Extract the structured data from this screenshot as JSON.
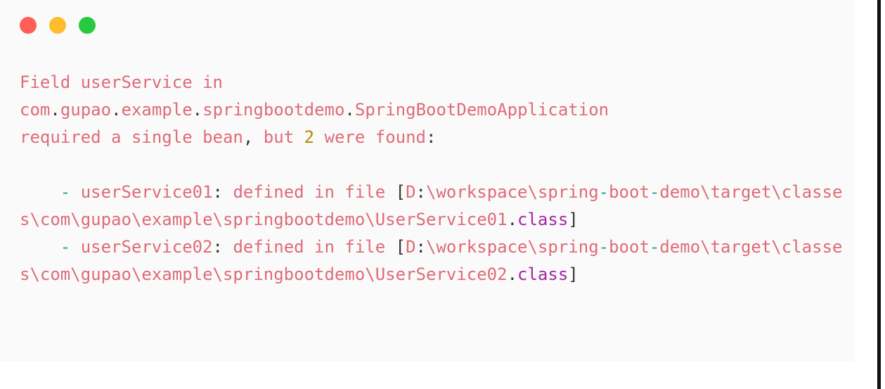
{
  "window": {
    "controls": [
      {
        "name": "close",
        "color": "#ff5f56"
      },
      {
        "name": "minimize",
        "color": "#ffbd2e"
      },
      {
        "name": "maximize",
        "color": "#27c93f"
      }
    ],
    "background": "#fafafa",
    "page_background": "#ffffff",
    "edge_stripe_color": "#111111"
  },
  "colors": {
    "text": "#df6b77",
    "number": "#b58900",
    "punctuation": "#333333",
    "dash": "#2aa198",
    "keyword": "#a626a4",
    "bracket": "#333333"
  },
  "console": {
    "lines": [
      {
        "id": "line-1",
        "tokens": [
          {
            "text": "Field userService in",
            "type": "txt"
          }
        ]
      },
      {
        "id": "line-2",
        "tokens": [
          {
            "text": "com",
            "type": "txt"
          },
          {
            "text": ".",
            "type": "punct"
          },
          {
            "text": "gupao",
            "type": "txt"
          },
          {
            "text": ".",
            "type": "punct"
          },
          {
            "text": "example",
            "type": "txt"
          },
          {
            "text": ".",
            "type": "punct"
          },
          {
            "text": "springbootdemo",
            "type": "txt"
          },
          {
            "text": ".",
            "type": "punct"
          },
          {
            "text": "SpringBootDemoApplication",
            "type": "txt"
          }
        ]
      },
      {
        "id": "line-3",
        "tokens": [
          {
            "text": "required a single bean",
            "type": "txt"
          },
          {
            "text": ",",
            "type": "punct"
          },
          {
            "text": " but ",
            "type": "txt"
          },
          {
            "text": "2",
            "type": "num"
          },
          {
            "text": " were found",
            "type": "txt"
          },
          {
            "text": ":",
            "type": "punct"
          }
        ]
      },
      {
        "id": "line-4",
        "blank": true,
        "tokens": []
      },
      {
        "id": "line-5",
        "tokens": [
          {
            "text": "    ",
            "type": "txt"
          },
          {
            "text": "-",
            "type": "dash"
          },
          {
            "text": " userService01",
            "type": "txt"
          },
          {
            "text": ":",
            "type": "punct"
          },
          {
            "text": " defined in file ",
            "type": "txt"
          },
          {
            "text": "[",
            "type": "bracket"
          },
          {
            "text": "D",
            "type": "txt"
          },
          {
            "text": ":",
            "type": "punct"
          },
          {
            "text": "\\workspace\\spring",
            "type": "txt"
          },
          {
            "text": "-",
            "type": "dash"
          },
          {
            "text": "boot",
            "type": "txt"
          },
          {
            "text": "-",
            "type": "dash"
          },
          {
            "text": "demo\\target\\classes\\com\\gupao\\example\\springbootdemo\\UserService01",
            "type": "txt"
          },
          {
            "text": ".",
            "type": "punct"
          },
          {
            "text": "class",
            "type": "kw"
          },
          {
            "text": "]",
            "type": "bracket"
          }
        ]
      },
      {
        "id": "line-6",
        "tokens": [
          {
            "text": "    ",
            "type": "txt"
          },
          {
            "text": "-",
            "type": "dash"
          },
          {
            "text": " userService02",
            "type": "txt"
          },
          {
            "text": ":",
            "type": "punct"
          },
          {
            "text": " defined in file ",
            "type": "txt"
          },
          {
            "text": "[",
            "type": "bracket"
          },
          {
            "text": "D",
            "type": "txt"
          },
          {
            "text": ":",
            "type": "punct"
          },
          {
            "text": "\\workspace\\spring",
            "type": "txt"
          },
          {
            "text": "-",
            "type": "dash"
          },
          {
            "text": "boot",
            "type": "txt"
          },
          {
            "text": "-",
            "type": "dash"
          },
          {
            "text": "demo\\target\\classes\\com\\gupao\\example\\springbootdemo\\UserService02",
            "type": "txt"
          },
          {
            "text": ".",
            "type": "punct"
          },
          {
            "text": "class",
            "type": "kw"
          },
          {
            "text": "]",
            "type": "bracket"
          }
        ]
      }
    ],
    "plain_text": "Field userService in\ncom.gupao.example.springbootdemo.SpringBootDemoApplication\nrequired a single bean, but 2 were found:\n\n    - userService01: defined in file [D:\\workspace\\spring-boot-demo\\target\\classes\\com\\gupao\\example\\springbootdemo\\UserService01.class]\n    - userService02: defined in file [D:\\workspace\\spring-boot-demo\\target\\classes\\com\\gupao\\example\\springbootdemo\\UserService02.class]"
  }
}
